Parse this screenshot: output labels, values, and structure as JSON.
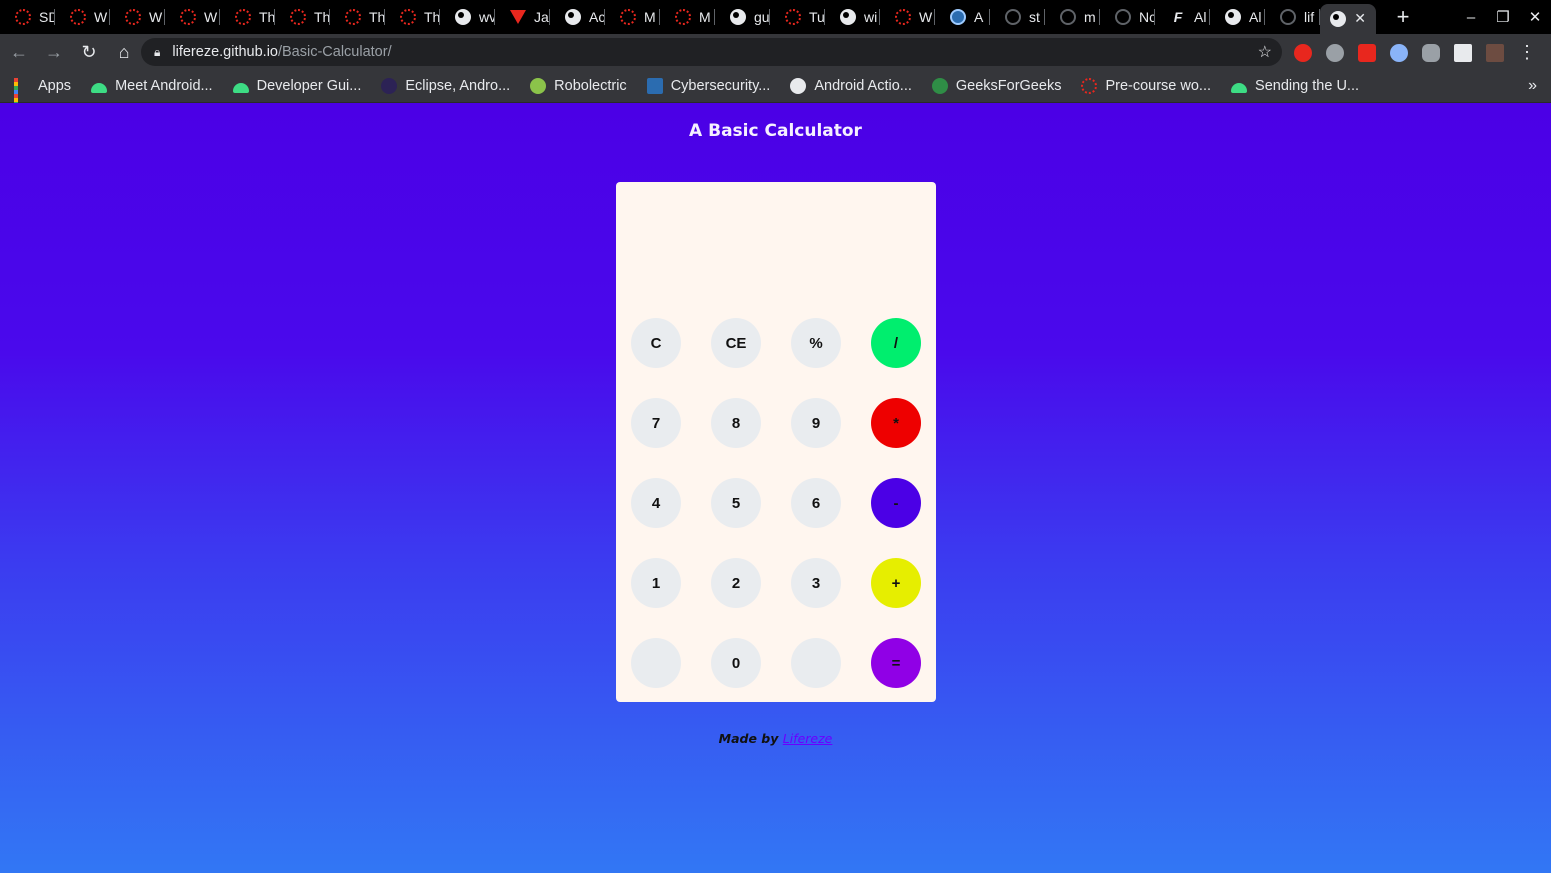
{
  "browser": {
    "tabs": [
      {
        "icon": "red-ring-icon",
        "label": "SD"
      },
      {
        "icon": "red-ring-icon",
        "label": "W"
      },
      {
        "icon": "red-ring-icon",
        "label": "W"
      },
      {
        "icon": "red-ring-icon",
        "label": "W"
      },
      {
        "icon": "red-ring-icon",
        "label": "Th"
      },
      {
        "icon": "red-ring-icon",
        "label": "Th"
      },
      {
        "icon": "red-ring-icon",
        "label": "Th"
      },
      {
        "icon": "red-ring-icon",
        "label": "Th"
      },
      {
        "icon": "globe-icon",
        "label": "wv"
      },
      {
        "icon": "angular-icon",
        "label": "Ja"
      },
      {
        "icon": "globe-icon",
        "label": "Ac"
      },
      {
        "icon": "red-ring-icon",
        "label": "M"
      },
      {
        "icon": "red-ring-icon",
        "label": "M"
      },
      {
        "icon": "globe-icon",
        "label": "gu"
      },
      {
        "icon": "red-ring-icon",
        "label": "Tu"
      },
      {
        "icon": "globe-icon",
        "label": "wi"
      },
      {
        "icon": "red-ring-icon",
        "label": "W"
      },
      {
        "icon": "blue-app-icon",
        "label": "A"
      },
      {
        "icon": "github-icon",
        "label": "st"
      },
      {
        "icon": "github-icon",
        "label": "m"
      },
      {
        "icon": "github-icon",
        "label": "Nc"
      },
      {
        "icon": "f-letter-icon",
        "label": "Al"
      },
      {
        "icon": "globe-icon",
        "label": "Al"
      },
      {
        "icon": "github-icon",
        "label": "lif"
      }
    ],
    "active_tab": {
      "icon": "globe-icon",
      "close": "✕"
    },
    "new_tab": "+",
    "window_controls": {
      "minimize": "–",
      "maximize": "❐",
      "close": "✕"
    },
    "nav": {
      "back": "←",
      "forward": "→",
      "reload": "↻",
      "home": "⌂"
    },
    "address": {
      "host": "lifereze.github.io",
      "path": "/Basic-Calculator/"
    },
    "bookmarks": [
      {
        "icon": "apps-grid-icon",
        "label": "Apps"
      },
      {
        "icon": "android-icon",
        "label": "Meet Android..."
      },
      {
        "icon": "android-icon",
        "label": "Developer Gui..."
      },
      {
        "icon": "eclipse-icon",
        "label": "Eclipse, Andro..."
      },
      {
        "icon": "robolectric-icon",
        "label": "Robolectric"
      },
      {
        "icon": "cyber-icon",
        "label": "Cybersecurity..."
      },
      {
        "icon": "globe-icon",
        "label": "Android Actio..."
      },
      {
        "icon": "gfg-icon",
        "label": "GeeksForGeeks"
      },
      {
        "icon": "red-ring-icon",
        "label": "Pre-course wo..."
      },
      {
        "icon": "android-icon",
        "label": "Sending the U..."
      }
    ],
    "bookmarks_more": "»"
  },
  "page": {
    "title": "A Basic Calculator",
    "display_value": "",
    "keys": [
      {
        "label": "C",
        "color": "#e9ecef",
        "name": "clear-button"
      },
      {
        "label": "CE",
        "color": "#e9ecef",
        "name": "clear-entry-button"
      },
      {
        "label": "%",
        "color": "#e9ecef",
        "name": "percent-button"
      },
      {
        "label": "/",
        "color": "#00ee6e",
        "name": "divide-button"
      },
      {
        "label": "7",
        "color": "#e9ecef",
        "name": "digit-7-button"
      },
      {
        "label": "8",
        "color": "#e9ecef",
        "name": "digit-8-button"
      },
      {
        "label": "9",
        "color": "#e9ecef",
        "name": "digit-9-button"
      },
      {
        "label": "*",
        "color": "#ee0000",
        "name": "multiply-button"
      },
      {
        "label": "4",
        "color": "#e9ecef",
        "name": "digit-4-button"
      },
      {
        "label": "5",
        "color": "#e9ecef",
        "name": "digit-5-button"
      },
      {
        "label": "6",
        "color": "#e9ecef",
        "name": "digit-6-button"
      },
      {
        "label": "-",
        "color": "#4b00e6",
        "name": "subtract-button"
      },
      {
        "label": "1",
        "color": "#e9ecef",
        "name": "digit-1-button"
      },
      {
        "label": "2",
        "color": "#e9ecef",
        "name": "digit-2-button"
      },
      {
        "label": "3",
        "color": "#e9ecef",
        "name": "digit-3-button"
      },
      {
        "label": "+",
        "color": "#e6ee00",
        "name": "add-button"
      },
      {
        "label": "",
        "color": "#e9ecef",
        "name": "blank-key-left"
      },
      {
        "label": "0",
        "color": "#e9ecef",
        "name": "digit-0-button"
      },
      {
        "label": "",
        "color": "#e9ecef",
        "name": "blank-key-right"
      },
      {
        "label": "=",
        "color": "#9000e6",
        "name": "equals-button"
      }
    ],
    "footer": {
      "prefix": "Made by",
      "link": "Lifereze"
    }
  },
  "colors": {
    "page_top": "#4b00e6",
    "page_bottom": "#3277f4",
    "calculator_body": "#fff6ef"
  }
}
